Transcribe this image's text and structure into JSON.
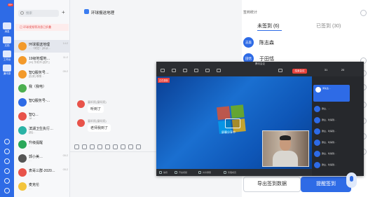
{
  "rail": {
    "badge": "99+",
    "items": [
      "消息",
      "文档",
      "工作台",
      "通讯录"
    ]
  },
  "list": {
    "search_placeholder": "搜索",
    "notice": "已 环球视频等消息已折叠",
    "rows": [
      {
        "name": "环球报送地理",
        "preview": "…（待定）[未读…",
        "time": "14:2",
        "color": "#f39a2b",
        "selected": true
      },
      {
        "name": "19级地理地…",
        "preview": "[33] 余老师:[图片]",
        "time": "11:2",
        "color": "#f39a2b",
        "selected": false
      },
      {
        "name": "智Q服务号…",
        "preview": "[投票] 尊敬…",
        "time": "05:2",
        "color": "#f39a2b",
        "selected": false
      },
      {
        "name": "我（我电）",
        "preview": "",
        "time": "",
        "color": "#4caf50",
        "selected": false
      },
      {
        "name": "智Q服务号-…",
        "preview": "…",
        "time": "",
        "color": "#2e6be6",
        "selected": false
      },
      {
        "name": "智Q…",
        "preview": "18 …",
        "time": "",
        "color": "#e8534a",
        "selected": false
      },
      {
        "name": "滨湖卫生执行…",
        "preview": "[图]…",
        "time": "",
        "color": "#2ab3a6",
        "selected": false
      },
      {
        "name": "升级提醒",
        "preview": "…",
        "time": "",
        "color": "#2aa85a",
        "selected": false
      },
      {
        "name": "郭小美…",
        "preview": "…",
        "time": "05:2",
        "color": "#555",
        "selected": false
      },
      {
        "name": "表哥三群-2020…",
        "preview": "…",
        "time": "05:2",
        "color": "#e8534a",
        "selected": false
      },
      {
        "name": "麦克伦",
        "preview": "…",
        "time": "",
        "color": "#f3c43b",
        "selected": false
      }
    ]
  },
  "chat": {
    "title": "环球报送地理",
    "messages": [
      {
        "name": "童昕熙(童昕熙)",
        "text": "听到了"
      },
      {
        "name": "童昕熙(童昕熙)",
        "text": "老师我到了"
      }
    ]
  },
  "sign": {
    "title": "签到统计",
    "tab_unsigned": "未签到 (6)",
    "tab_signed": "已签到 (30)",
    "people": [
      {
        "avatar": "志森",
        "name": "陈志森"
      },
      {
        "avatar": "田恬",
        "name": "于田恬"
      }
    ],
    "export_button": "导出签到数据",
    "remind_button": "提醒签到"
  },
  "meeting": {
    "window_title": "腾讯会议",
    "rec_label": "正在录制",
    "share_text": "屏幕分享中",
    "end_button": "结束会议",
    "counts": [
      "31",
      "20"
    ],
    "side_card_name": "郭先生…",
    "side_messages": [
      "群主、…",
      "群主、听得到…",
      "群主、听得到…",
      "群主、听得到…",
      "群主、听得到…",
      "群主、听得到…"
    ],
    "bottom": [
      "静音",
      "开启视频",
      "共享屏幕",
      "管理成员"
    ]
  }
}
